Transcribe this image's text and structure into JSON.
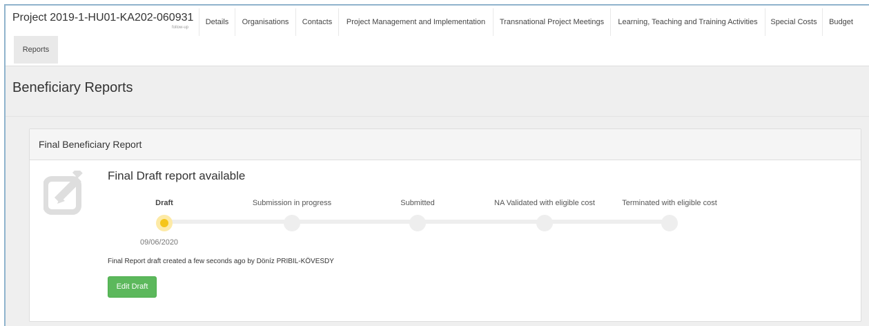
{
  "nav": {
    "project_title": "Project 2019-1-HU01-KA202-060931",
    "project_subtitle": "follow-up",
    "tabs": [
      {
        "label": "Details"
      },
      {
        "label": "Organisations"
      },
      {
        "label": "Contacts"
      },
      {
        "label": "Project Management and Implementation"
      },
      {
        "label": "Transnational Project Meetings"
      },
      {
        "label": "Learning, Teaching and Training Activities"
      },
      {
        "label": "Special Costs"
      },
      {
        "label": "Budget"
      },
      {
        "label": "Reports",
        "active": true
      }
    ]
  },
  "page": {
    "title": "Beneficiary Reports"
  },
  "panel": {
    "heading": "Final Beneficiary Report",
    "icon": "edit-document-icon",
    "status_title": "Final Draft report available",
    "steps": [
      {
        "label": "Draft",
        "current": true,
        "date": "09/06/2020"
      },
      {
        "label": "Submission in progress"
      },
      {
        "label": "Submitted"
      },
      {
        "label": "NA Validated with eligible cost"
      },
      {
        "label": "Terminated with eligible cost"
      }
    ],
    "info_line": "Final Report draft created a few seconds ago by Döníz PRIBIL-KÖVESDY",
    "edit_button": "Edit Draft"
  },
  "colors": {
    "frame_border": "#8fb3cc",
    "current_step": "#f5c518",
    "edit_button": "#5cb85c"
  }
}
